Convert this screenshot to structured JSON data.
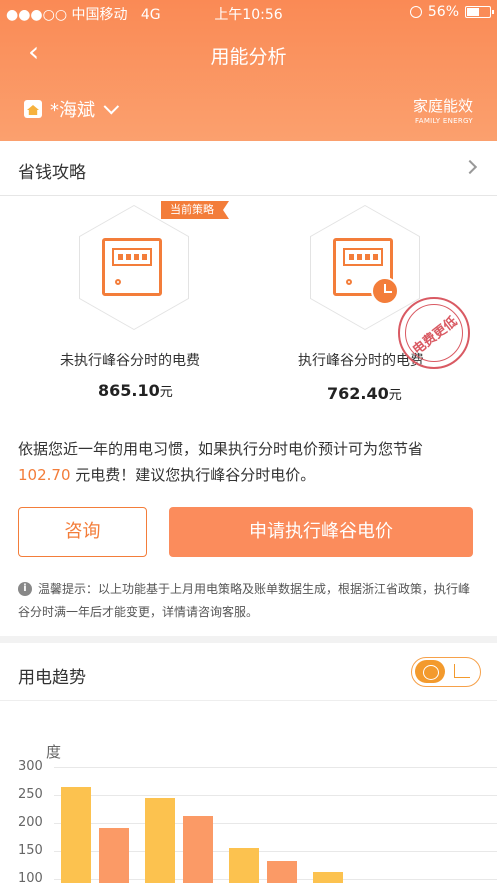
{
  "status_bar": {
    "carrier": "●●●○○ 中国移动",
    "network": "4G",
    "time": "上午10:56",
    "battery": "56%",
    "battery_level": 0.56
  },
  "header": {
    "title": "用能分析",
    "location": "*海斌",
    "brand_zh": "家庭能效",
    "brand_en": "FAMILY ENERGY",
    "back_glyph": "‹"
  },
  "strategy": {
    "title": "省钱攻略",
    "current_badge": "当前策略",
    "options": [
      {
        "label": "未执行峰谷分时的电费",
        "amount": "865.10",
        "unit": "元"
      },
      {
        "label": "执行峰谷分时的电费",
        "amount": "762.40",
        "unit": "元"
      }
    ],
    "stamp": "电费更低",
    "desc_prefix": "依据您近一年的用电习惯，如果执行分时电价预计可为您节省",
    "desc_amount": "102.70",
    "desc_suffix": " 元电费！建议您执行峰谷分时电价。",
    "consult_button": "咨询",
    "apply_button": "申请执行峰谷电价",
    "tip": "温馨提示：以上功能基于上月用电策略及账单数据生成，根据浙江省政策，执行峰谷分时满一年后才能变更，详情请咨询客服。"
  },
  "trend": {
    "title": "用电趋势",
    "icons": [
      "bar-chart-icon",
      "line-chart-icon"
    ],
    "colors": {
      "yellow": "#fcc24f",
      "orange": "#fb9a66"
    }
  },
  "chart_data": {
    "type": "bar",
    "ylabel": "度",
    "yticks": [
      "300",
      "250",
      "200",
      "150",
      "100"
    ],
    "series": [
      {
        "values": [
          265,
          245,
          155,
          113
        ]
      },
      {
        "values": [
          191,
          212,
          132
        ]
      }
    ]
  }
}
